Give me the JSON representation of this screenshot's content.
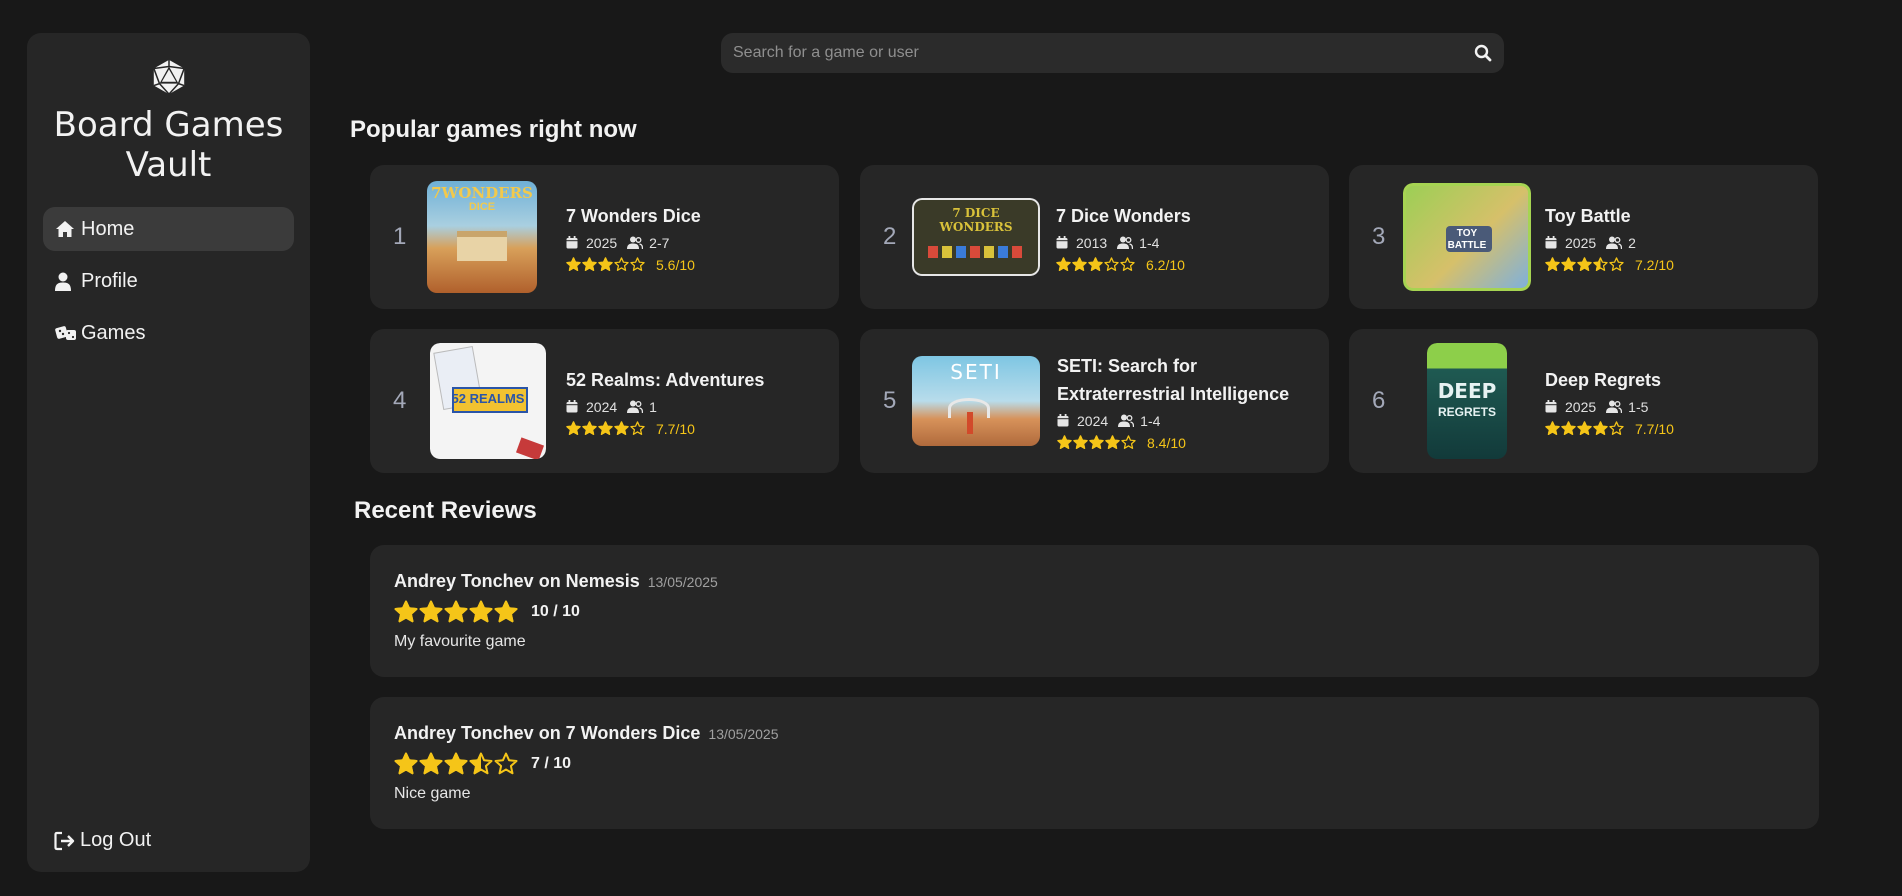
{
  "app": {
    "title": "Board Games Vault"
  },
  "nav": {
    "items": [
      {
        "label": "Home",
        "icon": "home-icon"
      },
      {
        "label": "Profile",
        "icon": "user-icon"
      },
      {
        "label": "Games",
        "icon": "dice-icon"
      }
    ],
    "logout": {
      "label": "Log Out",
      "icon": "logout-icon"
    }
  },
  "search": {
    "placeholder": "Search for a game or user",
    "value": ""
  },
  "popular": {
    "heading": "Popular games right now",
    "games": [
      {
        "rank": "1",
        "name": "7 Wonders Dice",
        "year": "2025",
        "players": "2-7",
        "rating_text": "5.6/10",
        "rating": 5.6
      },
      {
        "rank": "2",
        "name": "7 Dice Wonders",
        "year": "2013",
        "players": "1-4",
        "rating_text": "6.2/10",
        "rating": 6.2
      },
      {
        "rank": "3",
        "name": "Toy Battle",
        "year": "2025",
        "players": "2",
        "rating_text": "7.2/10",
        "rating": 7.2
      },
      {
        "rank": "4",
        "name": "52 Realms: Adventures",
        "year": "2024",
        "players": "1",
        "rating_text": "7.7/10",
        "rating": 7.7
      },
      {
        "rank": "5",
        "name": "SETI: Search for Extraterrestrial Intelligence",
        "year": "2024",
        "players": "1-4",
        "rating_text": "8.4/10",
        "rating": 8.4
      },
      {
        "rank": "6",
        "name": "Deep Regrets",
        "year": "2025",
        "players": "1-5",
        "rating_text": "7.7/10",
        "rating": 7.7
      }
    ],
    "cover_text": {
      "c1a": "7WONDERS",
      "c1b": "DICE",
      "c2": "7 DICE WONDERS",
      "c3a": "TOY",
      "c3b": "BATTLE",
      "c4": "52 REALMS",
      "c5": "SETI",
      "c6a": "DEEP",
      "c6b": "REGRETS"
    }
  },
  "reviews": {
    "heading": "Recent Reviews",
    "items": [
      {
        "author_game": "Andrey Tonchev on Nemesis",
        "date": "13/05/2025",
        "score": "10 / 10",
        "rating": 10,
        "text": "My favourite game"
      },
      {
        "author_game": "Andrey Tonchev on 7 Wonders Dice",
        "date": "13/05/2025",
        "score": "7 / 10",
        "rating": 7,
        "text": "Nice game"
      }
    ]
  },
  "colors": {
    "accent": "#f5c518",
    "background": "#181818",
    "panel": "#262626"
  }
}
